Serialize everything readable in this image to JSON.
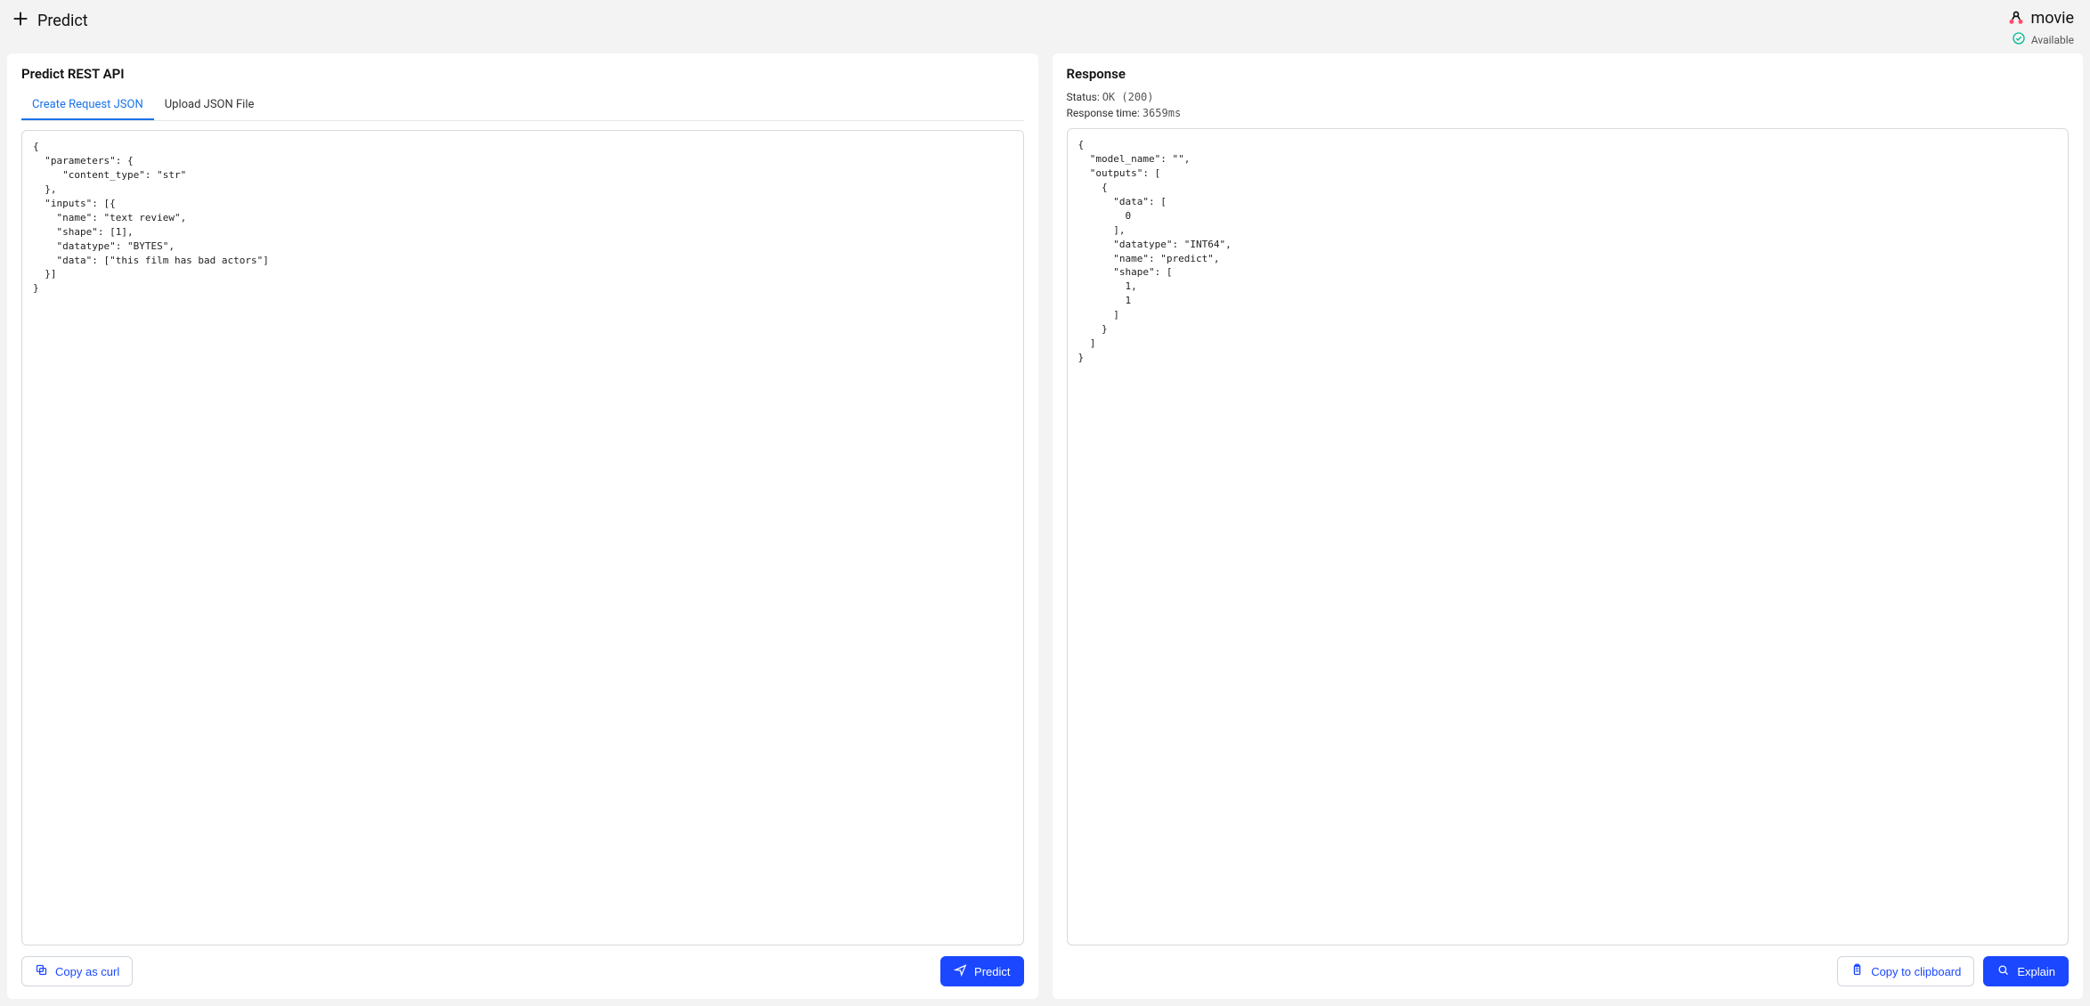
{
  "header": {
    "page_title": "Predict",
    "model_name": "movie",
    "availability_label": "Available"
  },
  "request_panel": {
    "title": "Predict REST API",
    "tabs": [
      {
        "label": "Create Request JSON",
        "active": true
      },
      {
        "label": "Upload JSON File",
        "active": false
      }
    ],
    "request_json": "{\n  \"parameters\": {\n     \"content_type\": \"str\"\n  },\n  \"inputs\": [{\n    \"name\": \"text review\",\n    \"shape\": [1],\n    \"datatype\": \"BYTES\",\n    \"data\": [\"this film has bad actors\"]\n  }]\n}",
    "copy_button_label": "Copy as curl",
    "predict_button_label": "Predict"
  },
  "response_panel": {
    "title": "Response",
    "status_label": "Status:",
    "status_value": "OK (200)",
    "time_label": "Response time:",
    "time_value": "3659ms",
    "response_json": "{\n  \"model_name\": \"\",\n  \"outputs\": [\n    {\n      \"data\": [\n        0\n      ],\n      \"datatype\": \"INT64\",\n      \"name\": \"predict\",\n      \"shape\": [\n        1,\n        1\n      ]\n    }\n  ]\n}",
    "copy_button_label": "Copy to clipboard",
    "explain_button_label": "Explain"
  }
}
